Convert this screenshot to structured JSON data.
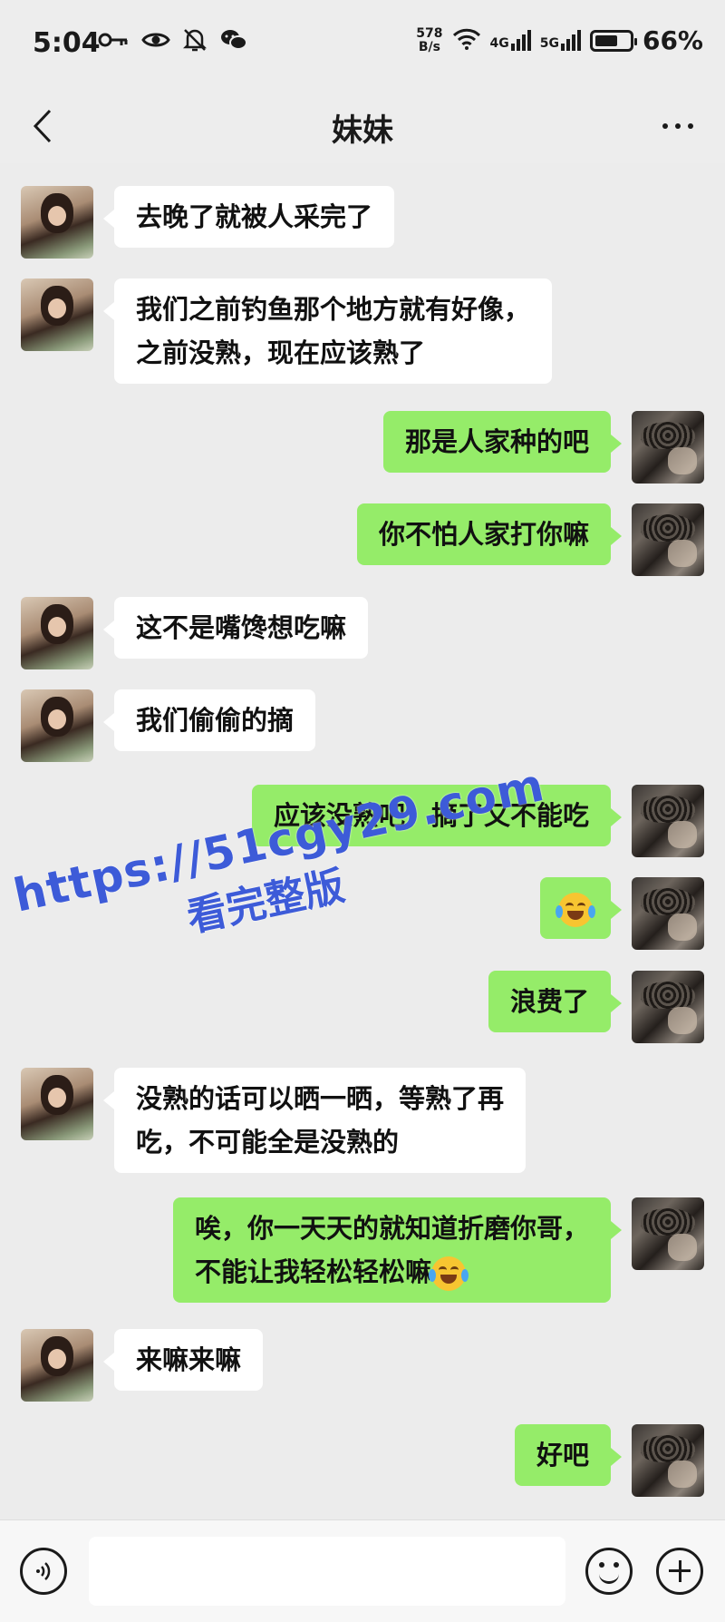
{
  "status_bar": {
    "time": "5:04",
    "net_speed_value": "578",
    "net_speed_unit": "B/s",
    "network_1": "4G",
    "network_2": "5G",
    "battery_percent": "66%",
    "battery_level": 0.66,
    "icons": [
      "key-icon",
      "eye-icon",
      "bell-off-icon",
      "wechat-icon",
      "wifi-icon",
      "signal-icon",
      "battery-icon"
    ]
  },
  "header": {
    "title": "妹妹",
    "back_icon": "chevron-left-icon",
    "more_icon": "more-dots-icon"
  },
  "messages": [
    {
      "side": "left",
      "text": "去晚了就被人采完了"
    },
    {
      "side": "left",
      "line1": "我们之前钓鱼那个地方就有好像，",
      "line2": "之前没熟，现在应该熟了"
    },
    {
      "side": "right",
      "text": "那是人家种的吧"
    },
    {
      "side": "right",
      "text": "你不怕人家打你嘛"
    },
    {
      "side": "left",
      "text": "这不是嘴馋想吃嘛"
    },
    {
      "side": "left",
      "text": "我们偷偷的摘"
    },
    {
      "side": "right",
      "text": "应该没熟吧，摘了又不能吃"
    },
    {
      "side": "right",
      "emoji": "tears-of-joy-emoji"
    },
    {
      "side": "right",
      "text": "浪费了"
    },
    {
      "side": "left",
      "line1": "没熟的话可以晒一晒，等熟了再",
      "line2": "吃，不可能全是没熟的"
    },
    {
      "side": "right",
      "line1": "唉，你一天天的就知道折磨你哥，",
      "line2": "不能让我轻松轻松嘛",
      "emoji": "tears-of-joy-emoji"
    },
    {
      "side": "left",
      "text": "来嘛来嘛"
    },
    {
      "side": "right",
      "text": "好吧"
    }
  ],
  "watermark": {
    "url": "https://51cgy29.com",
    "subtitle": "看完整版"
  },
  "input_bar": {
    "placeholder": "",
    "voice_icon": "voice-icon",
    "emoji_icon": "emoji-face-icon",
    "plus_icon": "plus-circle-icon"
  },
  "colors": {
    "background": "#ececec",
    "bubble_left": "#ffffff",
    "bubble_right": "#95ec69",
    "watermark": "#3d5bd8"
  }
}
